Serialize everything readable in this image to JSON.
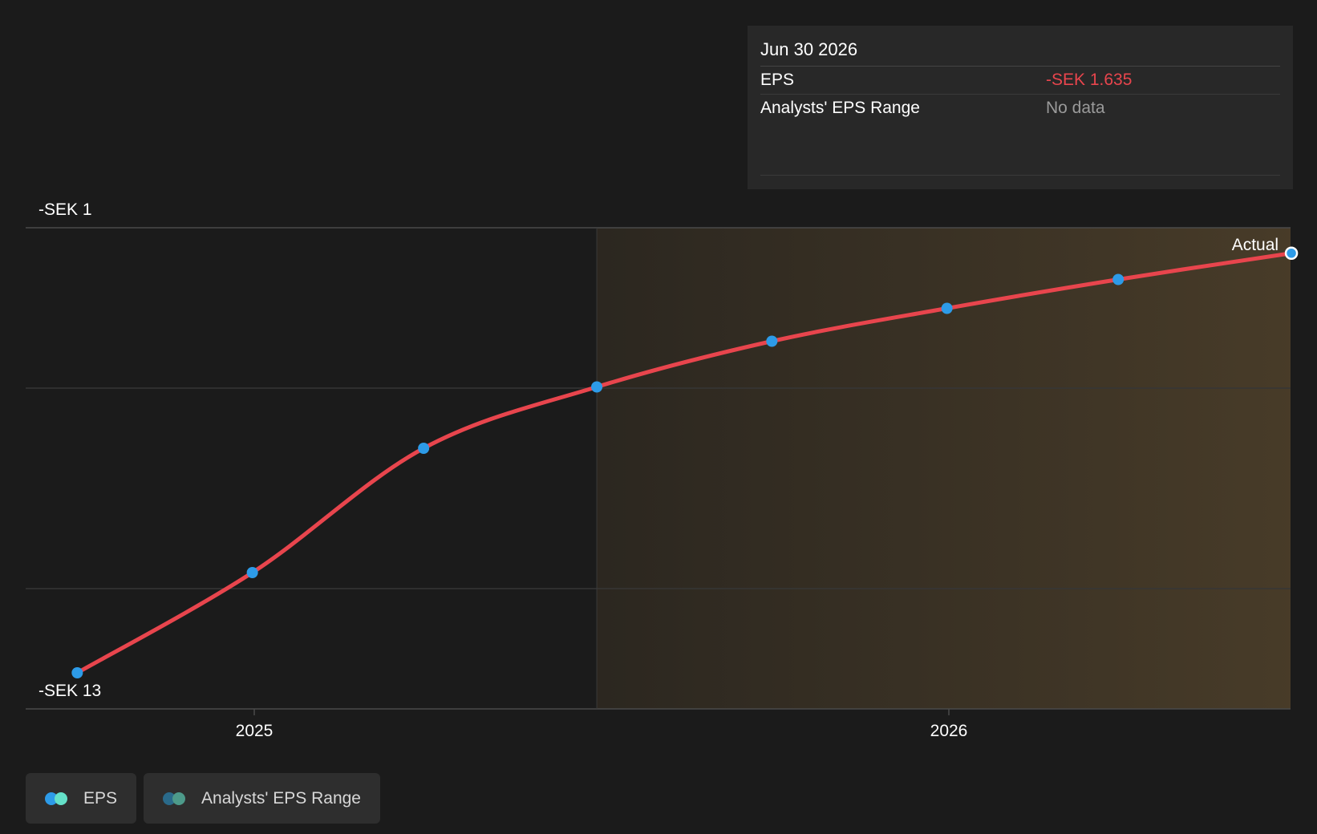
{
  "chart_data": {
    "type": "line",
    "y_axis": {
      "top_label": "-SEK 1",
      "bottom_label": "-SEK 13",
      "ylim": [
        -13,
        -1
      ]
    },
    "x_ticks": [
      "2025",
      "2026"
    ],
    "series": [
      {
        "name": "EPS",
        "color": "#e8454d",
        "marker_color": "#2d9be8",
        "points": [
          {
            "x": "2024-09-30",
            "y": -12.1
          },
          {
            "x": "2024-12-31",
            "y": -9.6
          },
          {
            "x": "2025-03-31",
            "y": -6.5
          },
          {
            "x": "2025-06-30",
            "y": -4.97
          },
          {
            "x": "2025-09-30",
            "y": -3.83
          },
          {
            "x": "2025-12-31",
            "y": -3.01
          },
          {
            "x": "2026-03-31",
            "y": -2.29
          },
          {
            "x": "2026-06-30",
            "y": -1.635
          }
        ]
      }
    ],
    "annotation": "Actual",
    "highlight_region": {
      "from": "2025-06-30",
      "to": "2026-06-30",
      "color": "#4a3d29"
    }
  },
  "tooltip": {
    "date": "Jun 30 2026",
    "rows": [
      {
        "label": "EPS",
        "value": "-SEK 1.635"
      },
      {
        "label": "Analysts' EPS Range",
        "value": "No data"
      }
    ]
  },
  "legend": [
    {
      "label": "EPS",
      "dot_colors": [
        "#2d9be8",
        "#64e0c8"
      ]
    },
    {
      "label": "Analysts' EPS Range",
      "dot_colors": [
        "#2a6a8a",
        "#4d9a8a"
      ]
    }
  ]
}
